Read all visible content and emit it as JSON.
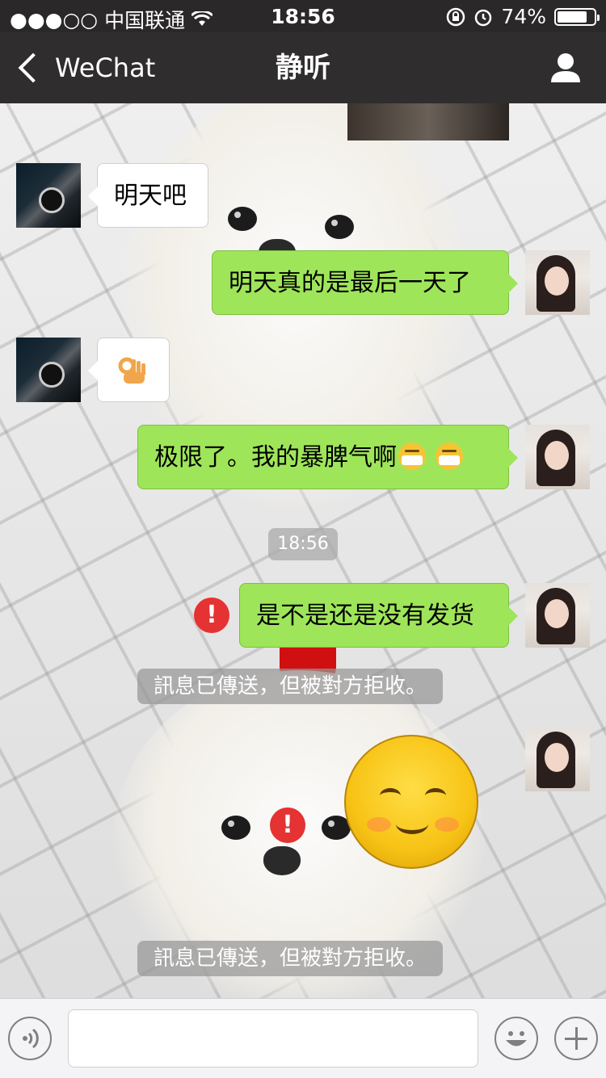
{
  "status_bar": {
    "signal": "●●●○○",
    "carrier": "中国联通",
    "time": "18:56",
    "battery_percent": "74%",
    "battery_level": 0.74
  },
  "nav": {
    "back_label": "WeChat",
    "title": "静听"
  },
  "messages": {
    "m1_text": "明天吧",
    "m2_text": "明天真的是最后一天了",
    "m3_icon": "ok-hand-emoji",
    "m4_text": "极限了。我的暴脾气啊",
    "m5_text": "是不是还是没有发货",
    "m6_icon": "shy-smile-sticker"
  },
  "timestamp": "18:56",
  "notices": {
    "n1": "訊息已傳送，但被對方拒收。",
    "n2": "訊息已傳送，但被對方拒收。"
  },
  "error_mark": "!",
  "input_bar": {
    "voice_icon": "voice-icon",
    "emoji_icon": "emoji-icon",
    "plus_icon": "plus-icon",
    "input_value": ""
  },
  "colors": {
    "nav_background": "#2f2d2d",
    "sent_bubble": "#9fe55a",
    "received_bubble": "#ffffff",
    "error": "#e53232"
  }
}
